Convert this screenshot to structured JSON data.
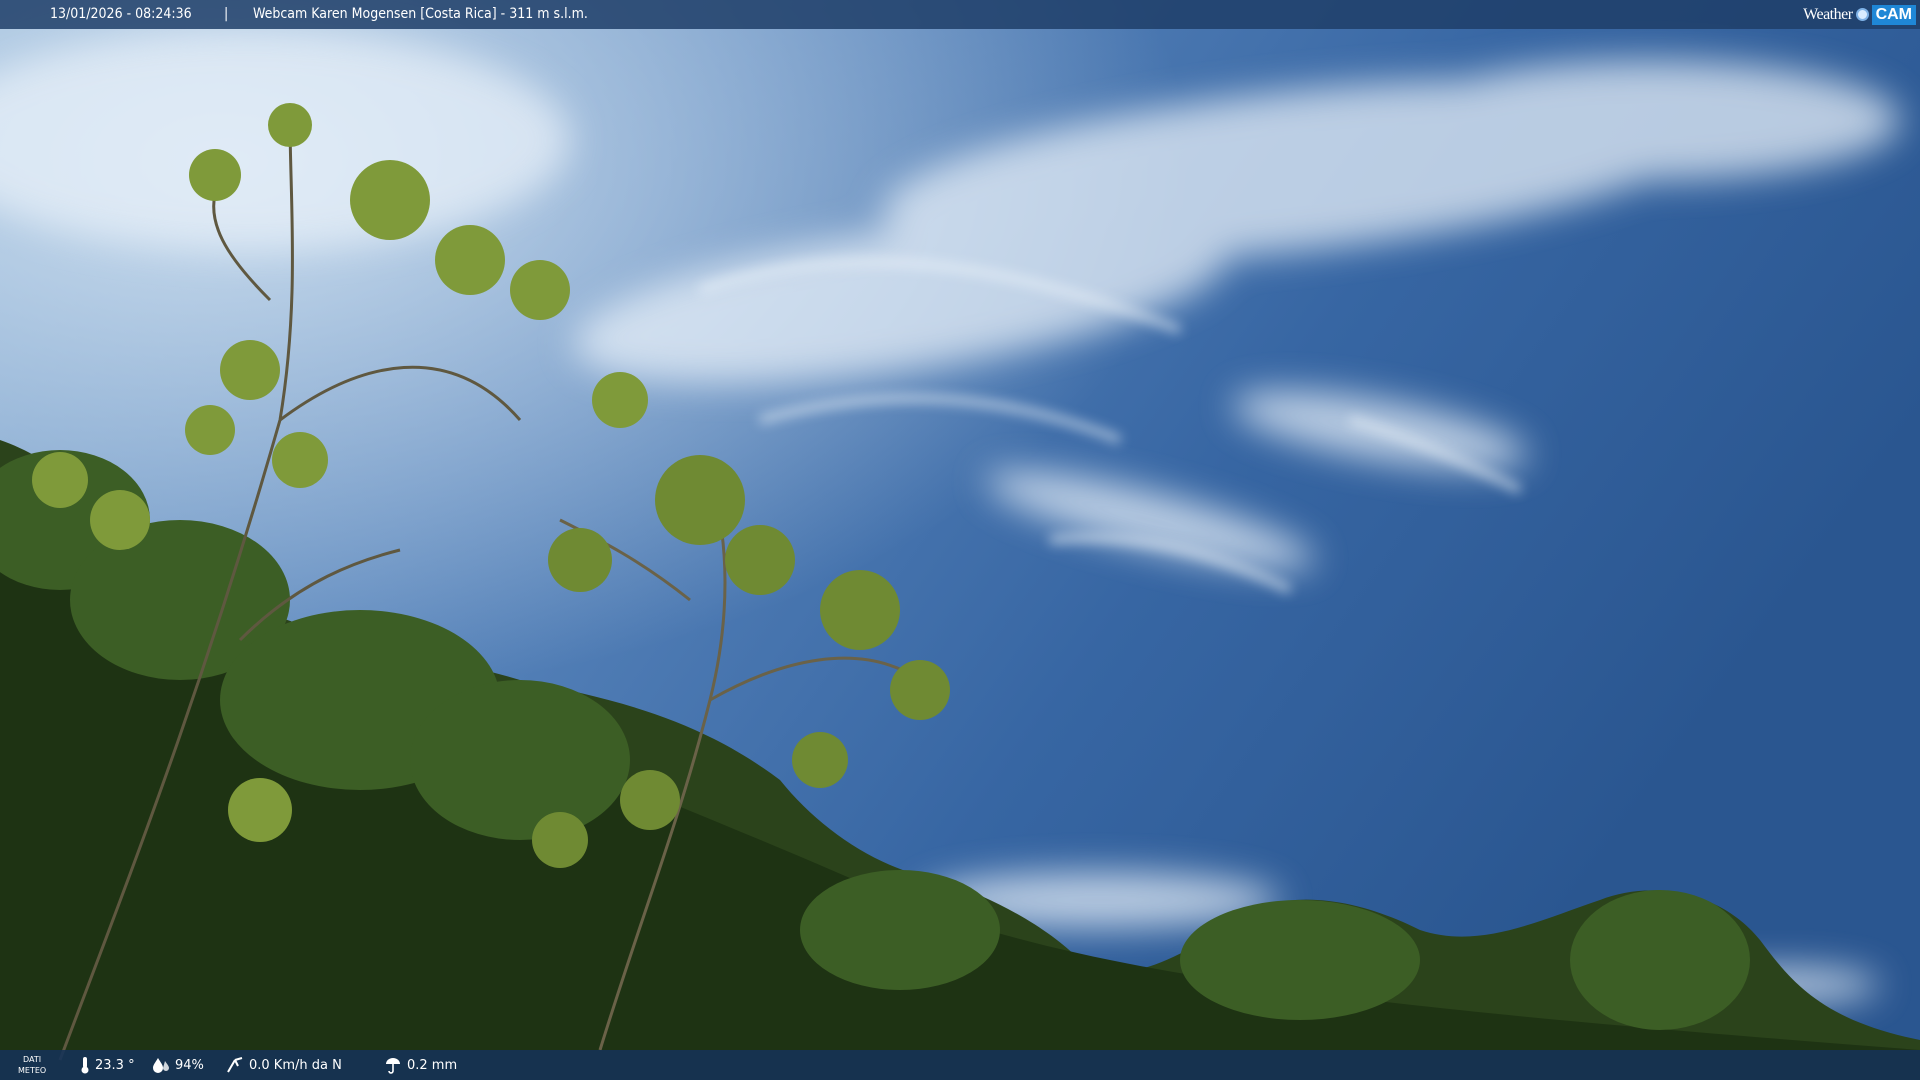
{
  "header": {
    "timestamp": "13/01/2026 - 08:24:36",
    "separator": "|",
    "webcam_title": "Webcam Karen Mogensen [Costa Rica] - 311 m s.l.m."
  },
  "logo": {
    "word1": "Weather",
    "word2": "CAM"
  },
  "footer": {
    "dati_line1": "DATI",
    "dati_line2": "METEO",
    "temperature": "23.3 °",
    "humidity": "94%",
    "wind": "0.0 Km/h da N",
    "rain": "0.2 mm"
  },
  "icons": [
    "thermometer-icon",
    "humidity-drop-icon",
    "wind-icon",
    "rain-gauge-icon",
    "globe-icon"
  ],
  "colors": {
    "sky_top": "#2f5e9a",
    "sky_light": "#8fb3d6",
    "foliage": "#2e4a1c",
    "bar": "#1e3e69",
    "logo_accent": "#1f87d6"
  }
}
